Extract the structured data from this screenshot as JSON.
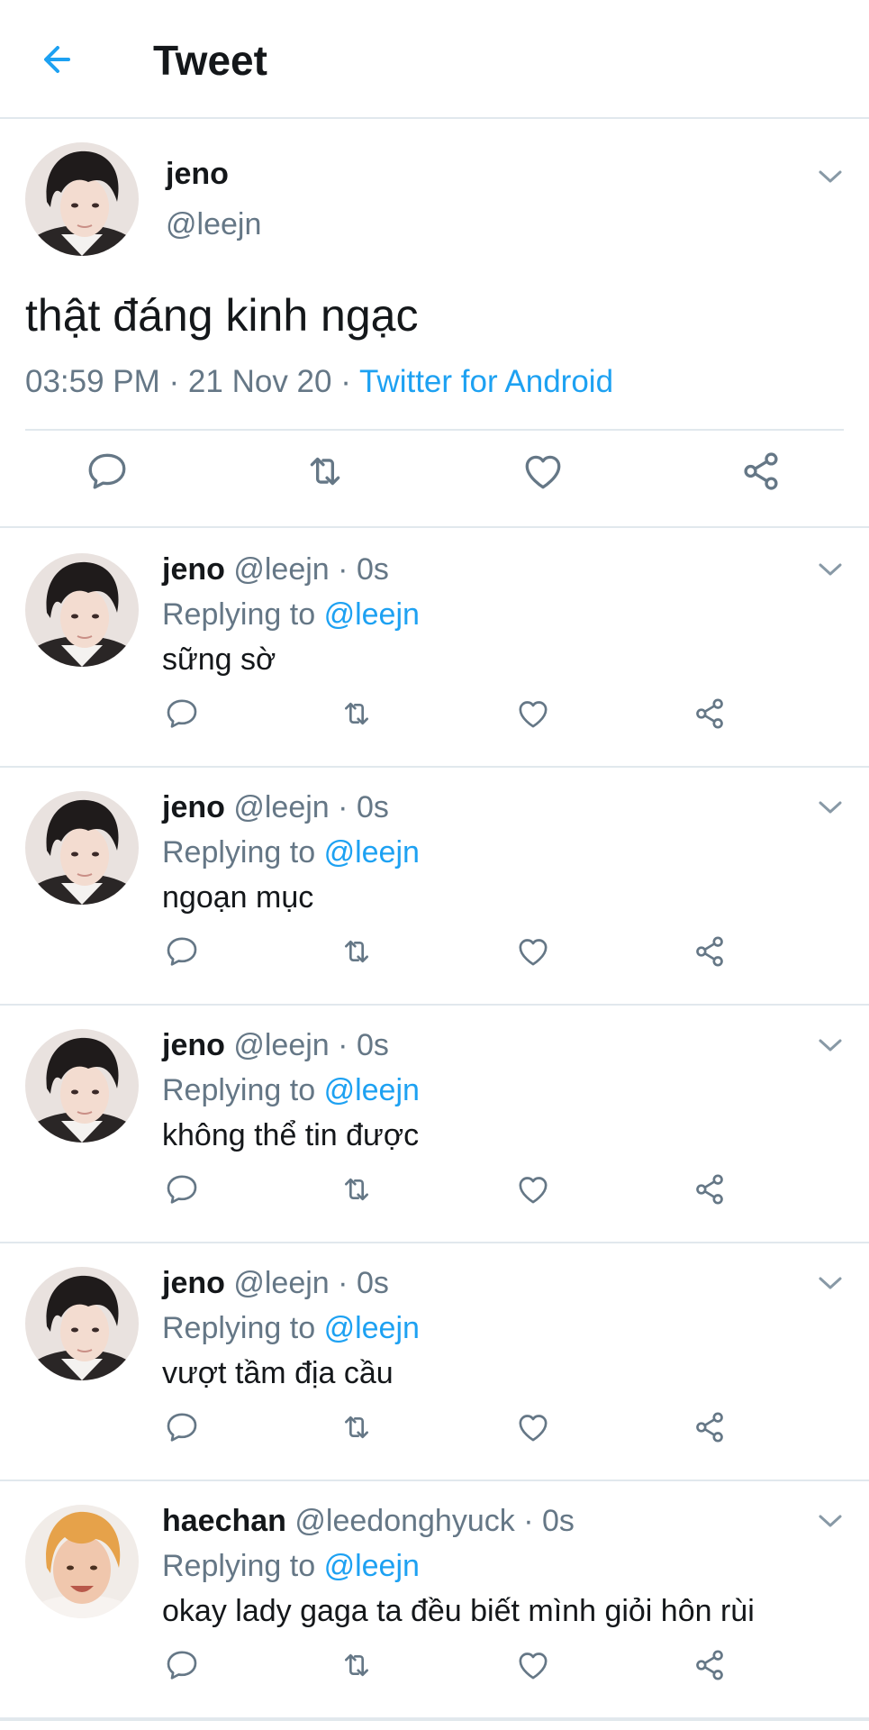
{
  "header": {
    "title": "Tweet"
  },
  "main_tweet": {
    "name": "jeno",
    "handle": "@leejn",
    "text": "thật đáng kinh ngạc",
    "time": "03:59 PM",
    "date": "21 Nov 20",
    "source": "Twitter for Android"
  },
  "replies": [
    {
      "name": "jeno",
      "handle": "@leejn",
      "time": "0s",
      "replying_label": "Replying to",
      "replying_handle": "@leejn",
      "text": "sững sờ"
    },
    {
      "name": "jeno",
      "handle": "@leejn",
      "time": "0s",
      "replying_label": "Replying to",
      "replying_handle": "@leejn",
      "text": "ngoạn mục"
    },
    {
      "name": "jeno",
      "handle": "@leejn",
      "time": "0s",
      "replying_label": "Replying to",
      "replying_handle": "@leejn",
      "text": "không thể tin được"
    },
    {
      "name": "jeno",
      "handle": "@leejn",
      "time": "0s",
      "replying_label": "Replying to",
      "replying_handle": "@leejn",
      "text": "vượt tầm địa cầu"
    },
    {
      "name": "haechan",
      "handle": "@leedonghyuck",
      "time": "0s",
      "replying_label": "Replying to",
      "replying_handle": "@leejn",
      "text": "okay lady gaga ta đều biết mình giỏi hôn rùi"
    }
  ],
  "icons": {
    "back": "arrow-left-icon",
    "more": "chevron-down-icon",
    "reply": "reply-icon",
    "retweet": "retweet-icon",
    "like": "heart-icon",
    "share": "share-icon"
  },
  "colors": {
    "accent": "#1da1f2",
    "secondary_text": "#657786",
    "divider": "#e1e8ed",
    "icon": "#657786"
  }
}
